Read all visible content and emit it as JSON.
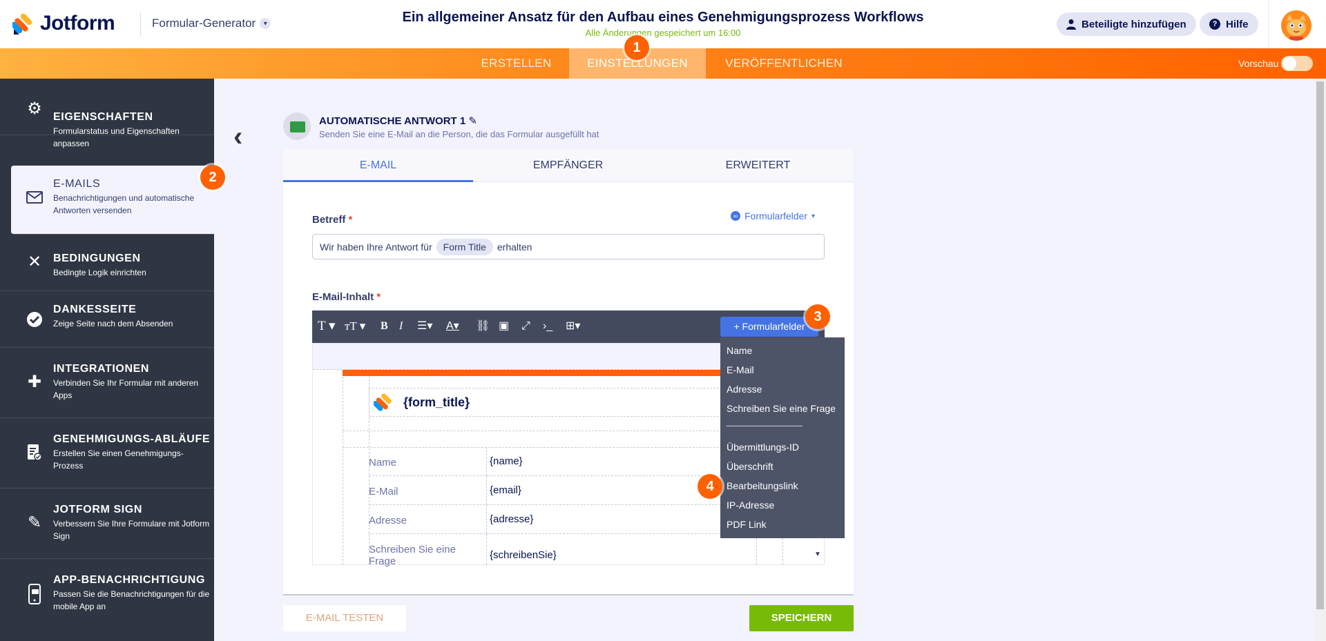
{
  "header": {
    "logo_text": "Jotform",
    "builder_switch": "Formular-Generator",
    "form_title": "Ein allgemeiner Ansatz für den Aufbau eines Genehmigungsprozess Workflows",
    "save_status": "Alle Änderungen gespeichert um 16:00",
    "add_participants": "Beteiligte hinzufügen",
    "help": "Hilfe",
    "icons": {
      "builder_chevron": "chevron-down-icon",
      "participants": "user-icon",
      "help": "question-icon"
    }
  },
  "nav": {
    "tabs": [
      "ERSTELLEN",
      "EINSTELLUNGEN",
      "VERÖFFENTLICHEN"
    ],
    "active_tab": "EINSTELLUNGEN",
    "preview_label": "Vorschau",
    "preview_on": false
  },
  "sidebar": {
    "items": [
      {
        "title": "EIGENSCHAFTEN",
        "desc": "Formularstatus und Eigenschaften anpassen",
        "icon": "gear-icon"
      },
      {
        "title": "E-MAILS",
        "desc": "Benachrichtigungen und automatische Antworten versenden",
        "icon": "envelope-icon"
      },
      {
        "title": "BEDINGUNGEN",
        "desc": "Bedingte Logik einrichten",
        "icon": "shuffle-icon"
      },
      {
        "title": "DANKESSEITE",
        "desc": "Zeige Seite nach dem Absenden",
        "icon": "check-circle-icon"
      },
      {
        "title": "INTEGRATIONEN",
        "desc": "Verbinden Sie Ihr Formular mit anderen Apps",
        "icon": "puzzle-icon"
      },
      {
        "title": "GENEHMIGUNGS-ABLÄUFE",
        "desc": "Erstellen Sie einen Genehmigungs-Prozess",
        "icon": "approval-icon"
      },
      {
        "title": "JOTFORM SIGN",
        "desc": "Verbessern Sie Ihre Formulare mit Jotform Sign",
        "icon": "pen-icon"
      },
      {
        "title": "APP-BENACHRICHTIGUNG",
        "desc": "Passen Sie die Benachrichtigungen für die mobile App an",
        "icon": "mobile-icon"
      }
    ],
    "active": "E-MAILS"
  },
  "autoresponse": {
    "title": "AUTOMATISCHE ANTWORT 1",
    "subtitle": "Senden Sie eine E-Mail an die Person, die das Formular ausgefüllt hat",
    "tabs": [
      "E-MAIL",
      "EMPFÄNGER",
      "ERWEITERT"
    ],
    "active_tab": "E-MAIL"
  },
  "subject": {
    "label": "Betreff",
    "required_mark": "*",
    "formfields_link": "Formularfelder",
    "prefix": "Wir haben Ihre Antwort für",
    "chip": "Form Title",
    "suffix": "erhalten"
  },
  "email_body": {
    "label": "E-Mail-Inhalt",
    "required_mark": "*",
    "formfields_button": "+ Formularfelder",
    "form_title_placeholder": "{form_title}",
    "rows": [
      {
        "key": "Name",
        "value": "{name}"
      },
      {
        "key": "E-Mail",
        "value": "{email}"
      },
      {
        "key": "Adresse",
        "value": "{adresse}"
      },
      {
        "key": "Schreiben Sie eine Frage",
        "value": "{schreibenSie}"
      }
    ]
  },
  "formfields_dropdown": {
    "items": [
      "Name",
      "E-Mail",
      "Adresse",
      "Schreiben Sie eine Frage",
      "———————————",
      "Übermittlungs-ID",
      "Überschrift",
      "Bearbeitungslink",
      "IP-Adresse",
      "PDF Link"
    ]
  },
  "footer": {
    "test_email": "E-MAIL TESTEN",
    "save": "SPEICHERN"
  },
  "markers": [
    "1",
    "2",
    "3",
    "4"
  ],
  "colors": {
    "brand_orange": "#ff6100",
    "nav_active": "#ffb56a",
    "sidebar_bg": "#2f3542",
    "accent_blue": "#4573e3",
    "save_green": "#78bb07",
    "dropdown_bg": "#4d5468"
  }
}
